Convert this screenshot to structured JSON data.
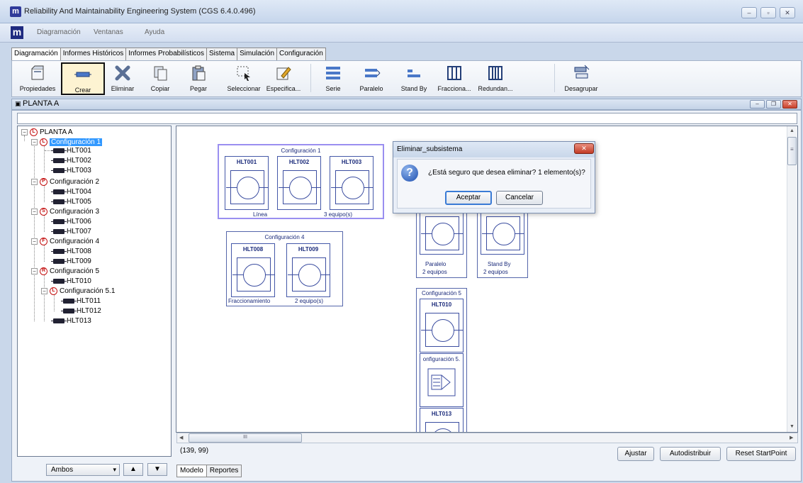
{
  "window": {
    "title": "Reliability And Maintainability Engineering System (CGS 6.4.0.496)",
    "icon_letter": "m",
    "controls": [
      "–",
      "▫",
      "✕"
    ]
  },
  "menubar": {
    "logo": "m",
    "items": [
      "Diagramación",
      "Ventanas",
      "Ayuda"
    ]
  },
  "tabs": [
    "Diagramación",
    "Informes Históricos",
    "Informes Probabilísticos",
    "Sistema",
    "Simulación",
    "Configuración"
  ],
  "toolbar": {
    "buttons": [
      "Propiedades",
      "Crear",
      "Eliminar",
      "Copiar",
      "Pegar",
      "Seleccionar",
      "Especifica...",
      "Serie",
      "Paralelo",
      "Stand By",
      "Fracciona...",
      "Redundan...",
      "Desagrupar"
    ]
  },
  "inner_window": {
    "title": "PLANTA A",
    "controls": [
      "–",
      "❐",
      "✕"
    ]
  },
  "tree": {
    "root": "PLANTA A",
    "nodes": {
      "c1": "Configuración 1",
      "c1_badge": "L",
      "e1": "HLT001",
      "e2": "HLT002",
      "e3": "HLT003",
      "c2": "Configuración 2",
      "c2_badge": "P",
      "e4": "HLT004",
      "e5": "HLT005",
      "c3": "Configuración 3",
      "c3_badge": "S",
      "e6": "HLT006",
      "e7": "HLT007",
      "c4": "Configuración 4",
      "c4_badge": "F",
      "e8": "HLT008",
      "e9": "HLT009",
      "c5": "Configuración 5",
      "c5_badge": "R",
      "e10": "HLT010",
      "c51": "Configuración 5.1",
      "c51_badge": "L",
      "e11": "HLT011",
      "e12": "HLT012",
      "e13": "HLT013",
      "root_badge": "L",
      "expander": "−"
    },
    "filter_value": "Ambos",
    "combo_arrow": "▾",
    "up": "▲",
    "down": "▼"
  },
  "diagram": {
    "g1": {
      "title": "Configuración 1",
      "items": [
        "HLT001",
        "HLT002",
        "HLT003"
      ],
      "foot_left": "Línea",
      "foot_right": "3 equipo(s)"
    },
    "g4": {
      "title": "Configuración 4",
      "items": [
        "HLT008",
        "HLT009"
      ],
      "foot_left": "Fraccionamiento",
      "foot_right": "2 equipo(s)"
    },
    "g2": {
      "foot1": "Paralelo",
      "foot2": "2 equipos"
    },
    "g3": {
      "foot1": "Stand By",
      "foot2": "2 equipos"
    },
    "g5": {
      "title": "Configuración 5",
      "item1": "HLT010",
      "sub": "onfiguración 5.",
      "item2": "HLT013"
    }
  },
  "scrollbar": {
    "grip": "III",
    "up": "▲",
    "down": "▼",
    "left": "◀",
    "right": "▶",
    "grip_v": "≡"
  },
  "status": {
    "coords": "(139, 99)",
    "ajustar": "Ajustar",
    "autodistribuir": "Autodistribuir",
    "reset": "Reset StartPoint"
  },
  "bottom_tabs": [
    "Modelo",
    "Reportes"
  ],
  "dialog": {
    "title": "Eliminar_subsistema",
    "close": "✕",
    "icon": "?",
    "message": "¿Está seguro que desea eliminar? 1 elemento(s)?",
    "ok": "Aceptar",
    "cancel": "Cancelar"
  },
  "colors": {
    "accent": "#3399ff",
    "diagram_line": "#3b4da0",
    "selection": "#9a8ff0",
    "badge": "#c41010"
  }
}
